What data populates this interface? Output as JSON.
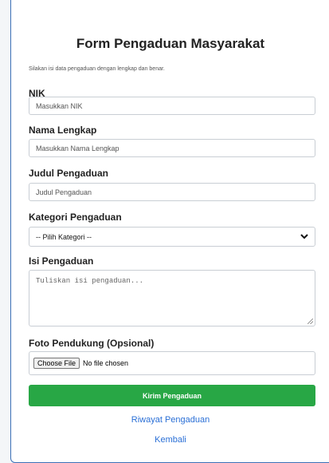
{
  "form": {
    "title": "Form Pengaduan Masyarakat",
    "subtitle": "Silakan isi data pengaduan dengan lengkap dan benar.",
    "nik": {
      "label": "NIK",
      "placeholder": "Masukkan NIK"
    },
    "nama": {
      "label": "Nama Lengkap",
      "placeholder": "Masukkan Nama Lengkap"
    },
    "judul": {
      "label": "Judul Pengaduan",
      "placeholder": "Judul Pengaduan"
    },
    "kategori": {
      "label": "Kategori Pengaduan",
      "selected": "-- Pilih Kategori --"
    },
    "isi": {
      "label": "Isi Pengaduan",
      "placeholder": "Tuliskan isi pengaduan..."
    },
    "foto": {
      "label": "Foto Pendukung (Opsional)",
      "button": "Choose File",
      "status": "No file chosen"
    },
    "submit_label": "Kirim Pengaduan",
    "link_riwayat": "Riwayat Pengaduan",
    "link_kembali": "Kembali"
  },
  "colors": {
    "submit": "#28a745",
    "link": "#2a6fd6",
    "card_border": "#3b6fb6"
  },
  "icons": {
    "select": "chevron-down-icon"
  }
}
